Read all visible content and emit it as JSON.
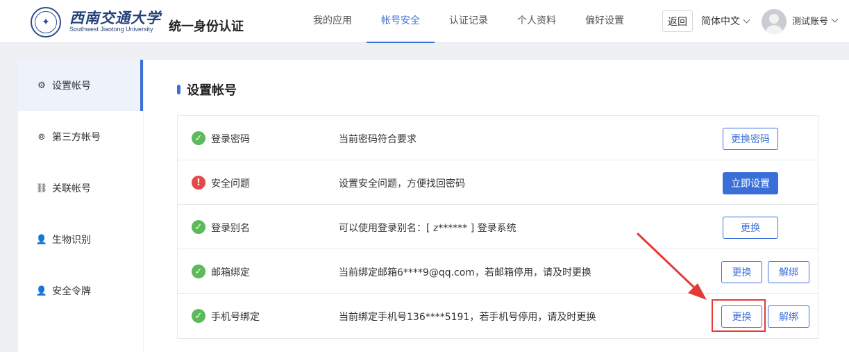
{
  "header": {
    "logo_icon": "university-seal-icon",
    "university_name": "西南交通大学",
    "university_name_en": "Southwest Jiaotong University",
    "app_title": "统一身份认证",
    "nav": [
      {
        "label": "我的应用"
      },
      {
        "label": "帐号安全"
      },
      {
        "label": "认证记录"
      },
      {
        "label": "个人资料"
      },
      {
        "label": "偏好设置"
      }
    ],
    "active_nav": "帐号安全",
    "back_label": "返回",
    "language": "简体中文",
    "username": "测试账号",
    "accent_color": "#3b6fd8"
  },
  "sidebar": {
    "items": [
      {
        "label": "设置帐号",
        "icon": "gear-icon"
      },
      {
        "label": "第三方帐号",
        "icon": "link-icon"
      },
      {
        "label": "关联帐号",
        "icon": "chain-icon"
      },
      {
        "label": "生物识别",
        "icon": "user-icon"
      },
      {
        "label": "安全令牌",
        "icon": "user-icon"
      }
    ],
    "active": "设置帐号"
  },
  "main": {
    "title": "设置帐号",
    "rows": [
      {
        "status": "ok",
        "label": "登录密码",
        "desc": "当前密码符合要求",
        "buttons": [
          "更换密码"
        ]
      },
      {
        "status": "warning",
        "label": "安全问题",
        "desc": "设置安全问题，方便找回密码",
        "buttons": [
          "立即设置"
        ]
      },
      {
        "status": "ok",
        "label": "登录别名",
        "desc": "可以使用登录别名：[ z****** ] 登录系统",
        "buttons": [
          "更换"
        ]
      },
      {
        "status": "ok",
        "label": "邮箱绑定",
        "desc": "当前绑定邮箱6****9@qq.com，若邮箱停用，请及时更换",
        "buttons": [
          "更换",
          "解绑"
        ]
      },
      {
        "status": "ok",
        "label": "手机号绑定",
        "desc": "当前绑定手机号136****5191，若手机号停用，请及时更换",
        "buttons": [
          "更换",
          "解绑"
        ]
      }
    ],
    "status_colors": {
      "ok": "#5cba5c",
      "warning": "#e64747"
    }
  },
  "annotation": {
    "highlight_color": "#e53935"
  }
}
